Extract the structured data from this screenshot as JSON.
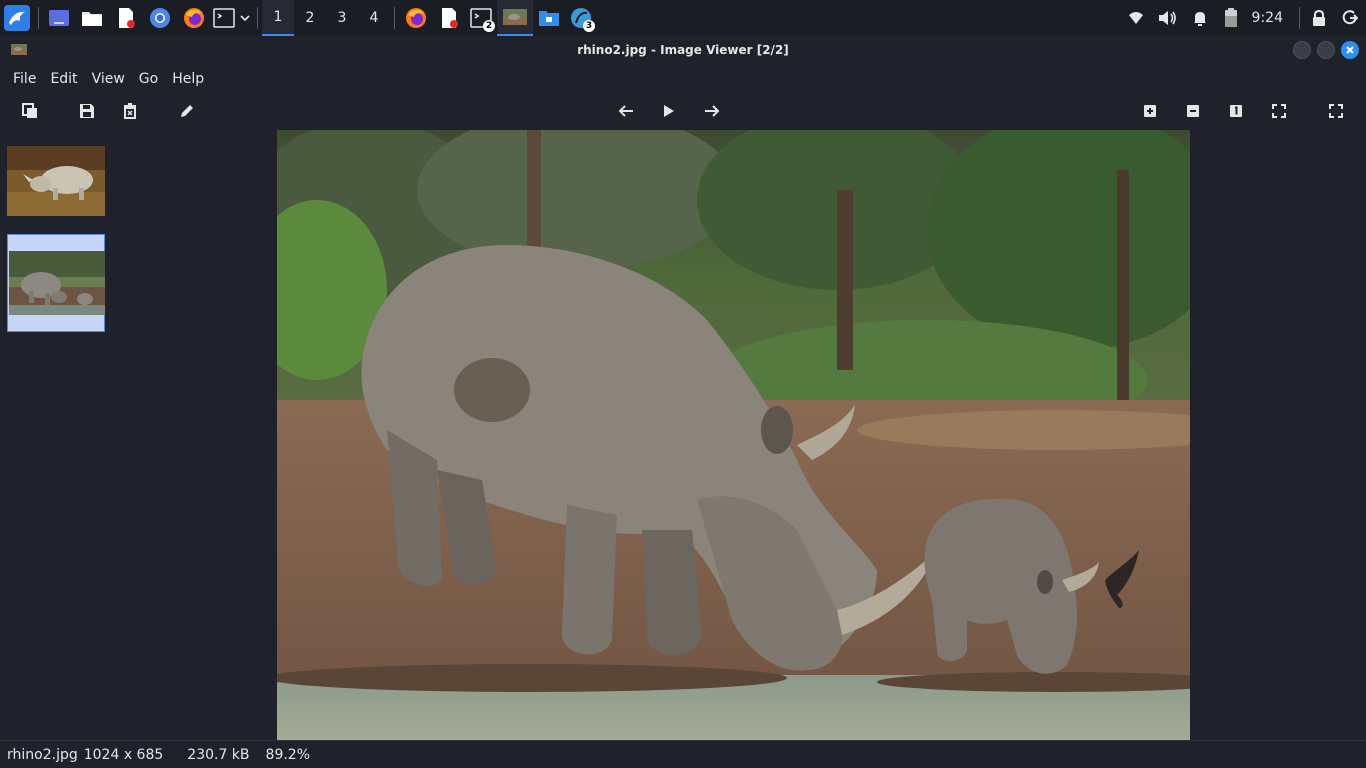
{
  "taskbar": {
    "workspaces": [
      "1",
      "2",
      "3",
      "4"
    ],
    "terminal_badge": "2",
    "browser_badge": "3",
    "clock": "9:24"
  },
  "window": {
    "title": "rhino2.jpg - Image Viewer [2/2]"
  },
  "menu": {
    "file": "File",
    "edit": "Edit",
    "view": "View",
    "go": "Go",
    "help": "Help"
  },
  "status": {
    "filename": "rhino2.jpg",
    "dimensions": "1024 x 685",
    "filesize": "230.7 kB",
    "zoom": "89.2%"
  },
  "colors": {
    "accent": "#2f8ff0",
    "background": "#1f222b",
    "selection": "#c5d6f6"
  }
}
